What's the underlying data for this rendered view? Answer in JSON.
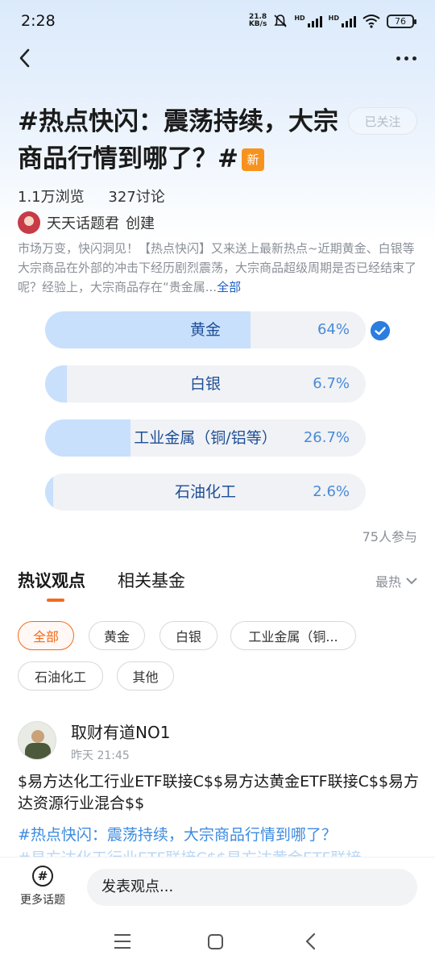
{
  "status_bar": {
    "time": "2:28",
    "net_speed_value": "21.8",
    "net_speed_unit": "KB/s",
    "hd_1": "HD",
    "hd_2": "HD",
    "battery": "76"
  },
  "topic": {
    "title": "#热点快闪：震荡持续，大宗商品行情到哪了？#",
    "new_badge": "新",
    "follow_label": "已关注",
    "views": "1.1万浏览",
    "discussions": "327讨论",
    "creator_name": "天天话题君",
    "creator_suffix": "创建",
    "description": "市场万变，快闪洞见！【热点快闪】又来送上最新热点~近期黄金、白银等大宗商品在外部的冲击下经历剧烈震荡，大宗商品超级周期是否已经结束了呢？经验上，大宗商品存在“贵金属...",
    "description_more": "全部"
  },
  "poll": {
    "options": [
      {
        "label": "黄金",
        "percent_text": "64%",
        "fraction": 0.64,
        "selected": true
      },
      {
        "label": "白银",
        "percent_text": "6.7%",
        "fraction": 0.067,
        "selected": false
      },
      {
        "label": "工业金属（铜/铝等）",
        "percent_text": "26.7%",
        "fraction": 0.267,
        "selected": false
      },
      {
        "label": "石油化工",
        "percent_text": "2.6%",
        "fraction": 0.026,
        "selected": false
      }
    ],
    "participants": "75人参与"
  },
  "tabs": {
    "active": "热议观点",
    "second": "相关基金",
    "sort": "最热"
  },
  "filter_chips": [
    "全部",
    "黄金",
    "白银",
    "工业金属（铜...",
    "石油化工",
    "其他"
  ],
  "post": {
    "author": "取财有道NO1",
    "time": "昨天 21:45",
    "text": "$易方达化工行业ETF联接C$$易方达黄金ETF联接C$$易方达资源行业混合$$",
    "topic_link": "#热点快闪：震荡持续，大宗商品行情到哪了？",
    "faded_line": "#易方达化工行业ETF联接C$$易方达黄金ETF联接"
  },
  "bottom_bar": {
    "more_topics_label": "更多话题",
    "comment_placeholder": "发表观点..."
  },
  "colors": {
    "accent_orange": "#f26b1d",
    "poll_fill": "#c8e0fb",
    "link_blue": "#3d8be0",
    "check_blue": "#2a7de1"
  }
}
